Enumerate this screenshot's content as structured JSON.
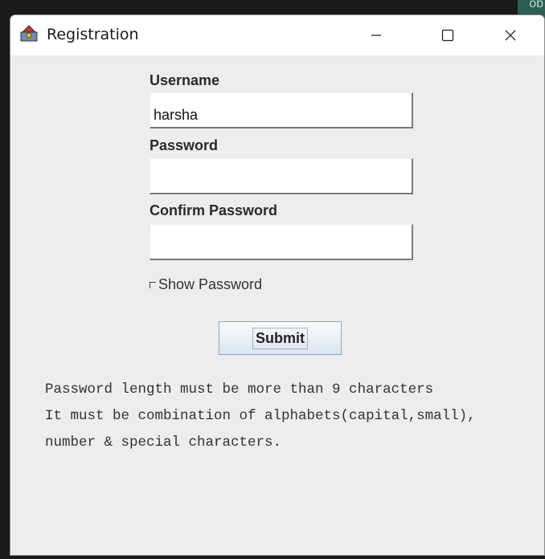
{
  "window": {
    "title": "Registration",
    "controls": [
      "minimize",
      "maximize",
      "close"
    ]
  },
  "background_text": "ob",
  "form": {
    "username_label": "Username",
    "username_value": "harsha",
    "password_label": "Password",
    "password_value": "",
    "confirm_label": "Confirm Password",
    "confirm_value": "",
    "show_password_label": "Show Password",
    "show_password_checked": false,
    "submit_label": "Submit"
  },
  "info": {
    "line1": "Password length must be more than 9 characters",
    "line2": "It must be combination of alphabets(capital,small),",
    "line3": "number & special characters."
  }
}
